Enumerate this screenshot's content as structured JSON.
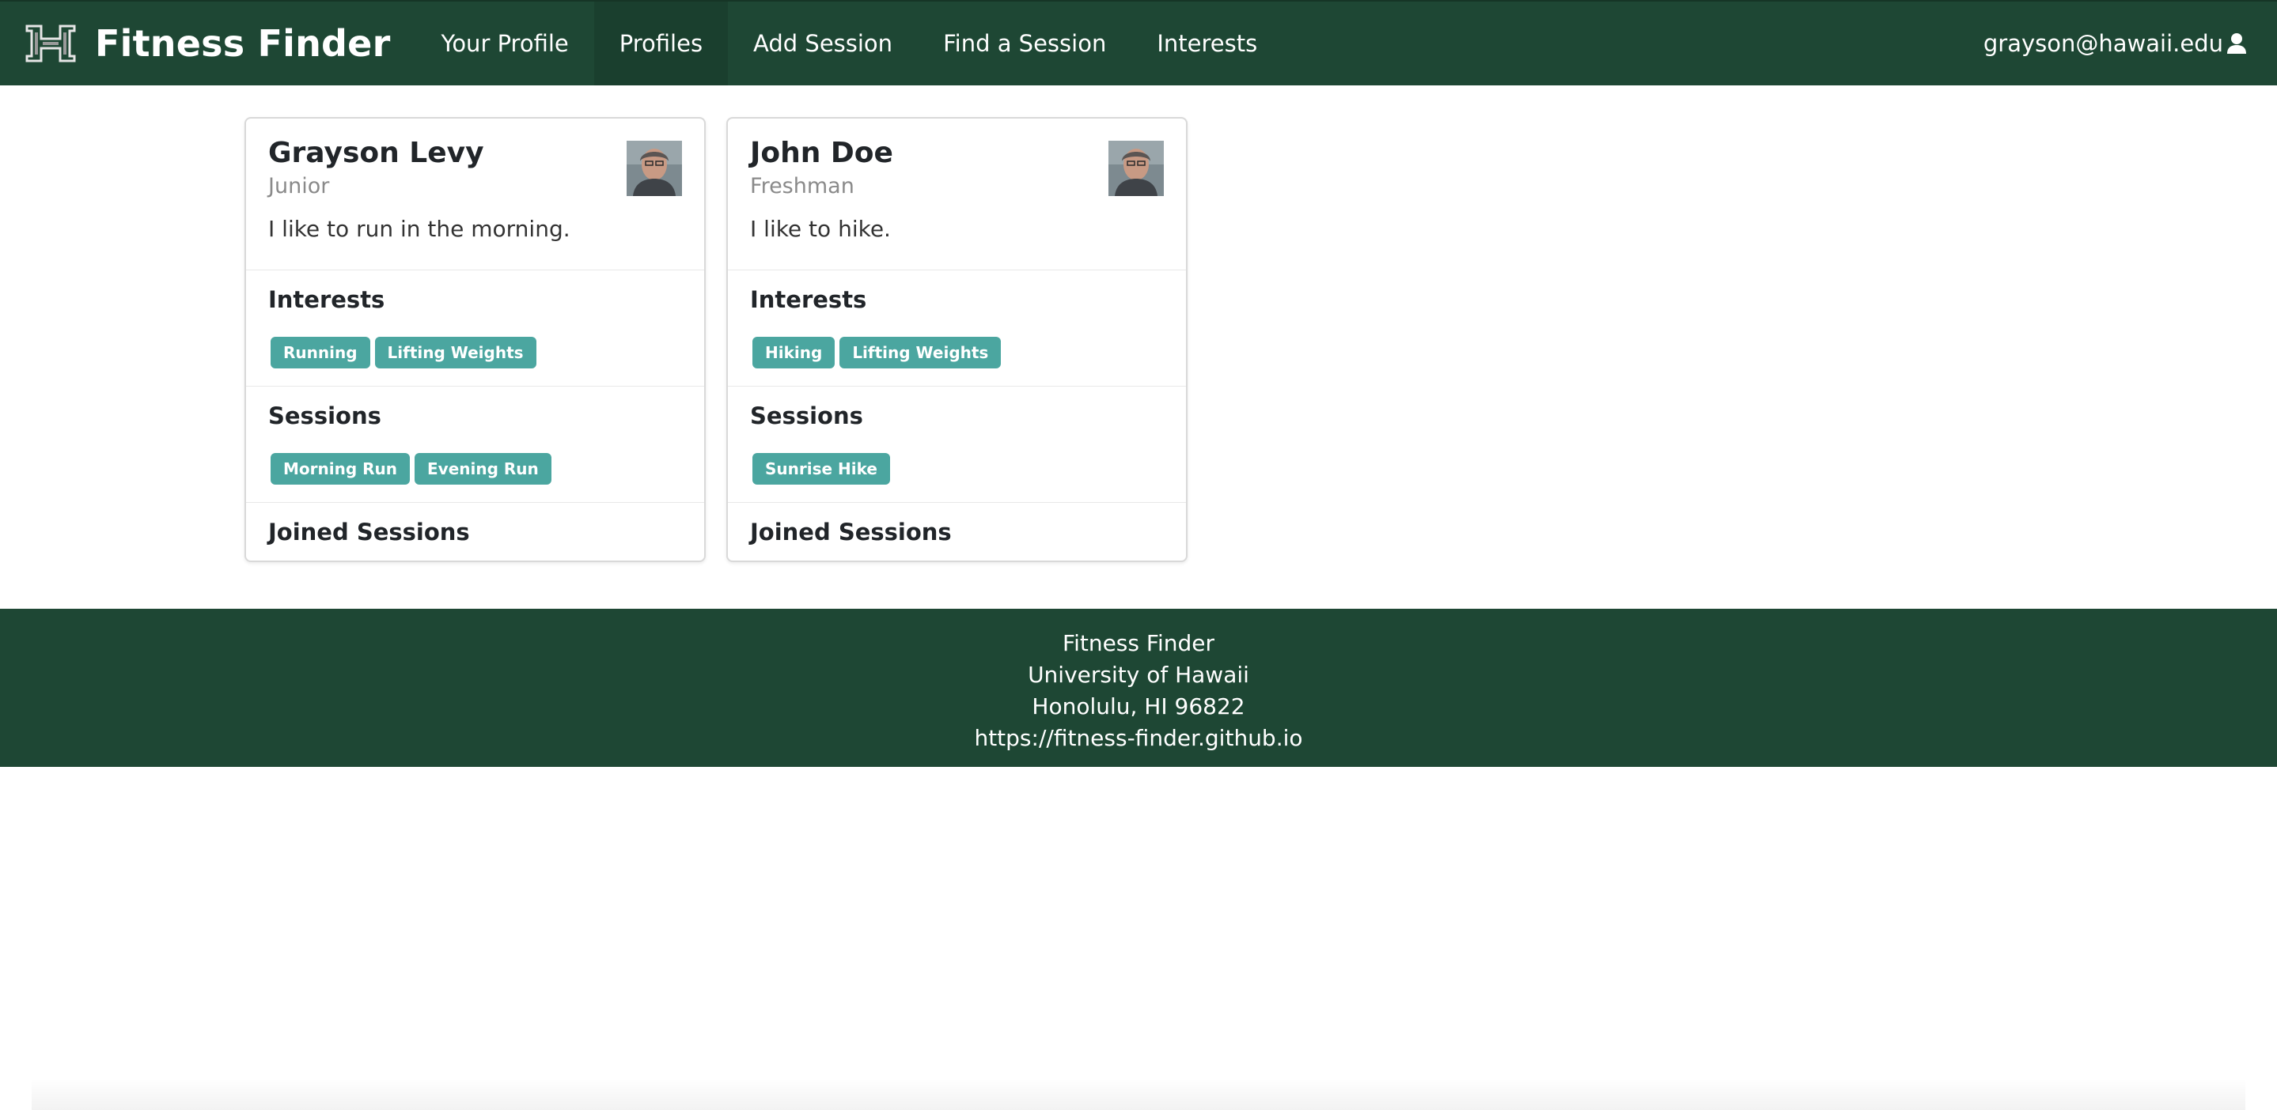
{
  "navbar": {
    "brand": "Fitness Finder",
    "links": [
      {
        "label": "Your Profile"
      },
      {
        "label": "Profiles"
      },
      {
        "label": "Add Session"
      },
      {
        "label": "Find a Session"
      },
      {
        "label": "Interests"
      }
    ],
    "user_email": "grayson@hawaii.edu"
  },
  "profiles": [
    {
      "name": "Grayson Levy",
      "year": "Junior",
      "bio": "I like to run in the morning.",
      "interests_title": "Interests",
      "interests": [
        "Running",
        "Lifting Weights"
      ],
      "sessions_title": "Sessions",
      "sessions": [
        "Morning Run",
        "Evening Run"
      ],
      "joined_title": "Joined Sessions"
    },
    {
      "name": "John Doe",
      "year": "Freshman",
      "bio": "I like to hike.",
      "interests_title": "Interests",
      "interests": [
        "Hiking",
        "Lifting Weights"
      ],
      "sessions_title": "Sessions",
      "sessions": [
        "Sunrise Hike"
      ],
      "joined_title": "Joined Sessions"
    }
  ],
  "footer": {
    "line1": "Fitness Finder",
    "line2": "University of Hawaii",
    "line3": "Honolulu, HI 96822",
    "line4": "https://fitness-finder.github.io"
  },
  "colors": {
    "navbar_bg": "#1e4734",
    "label_bg": "#4ba6a0"
  }
}
